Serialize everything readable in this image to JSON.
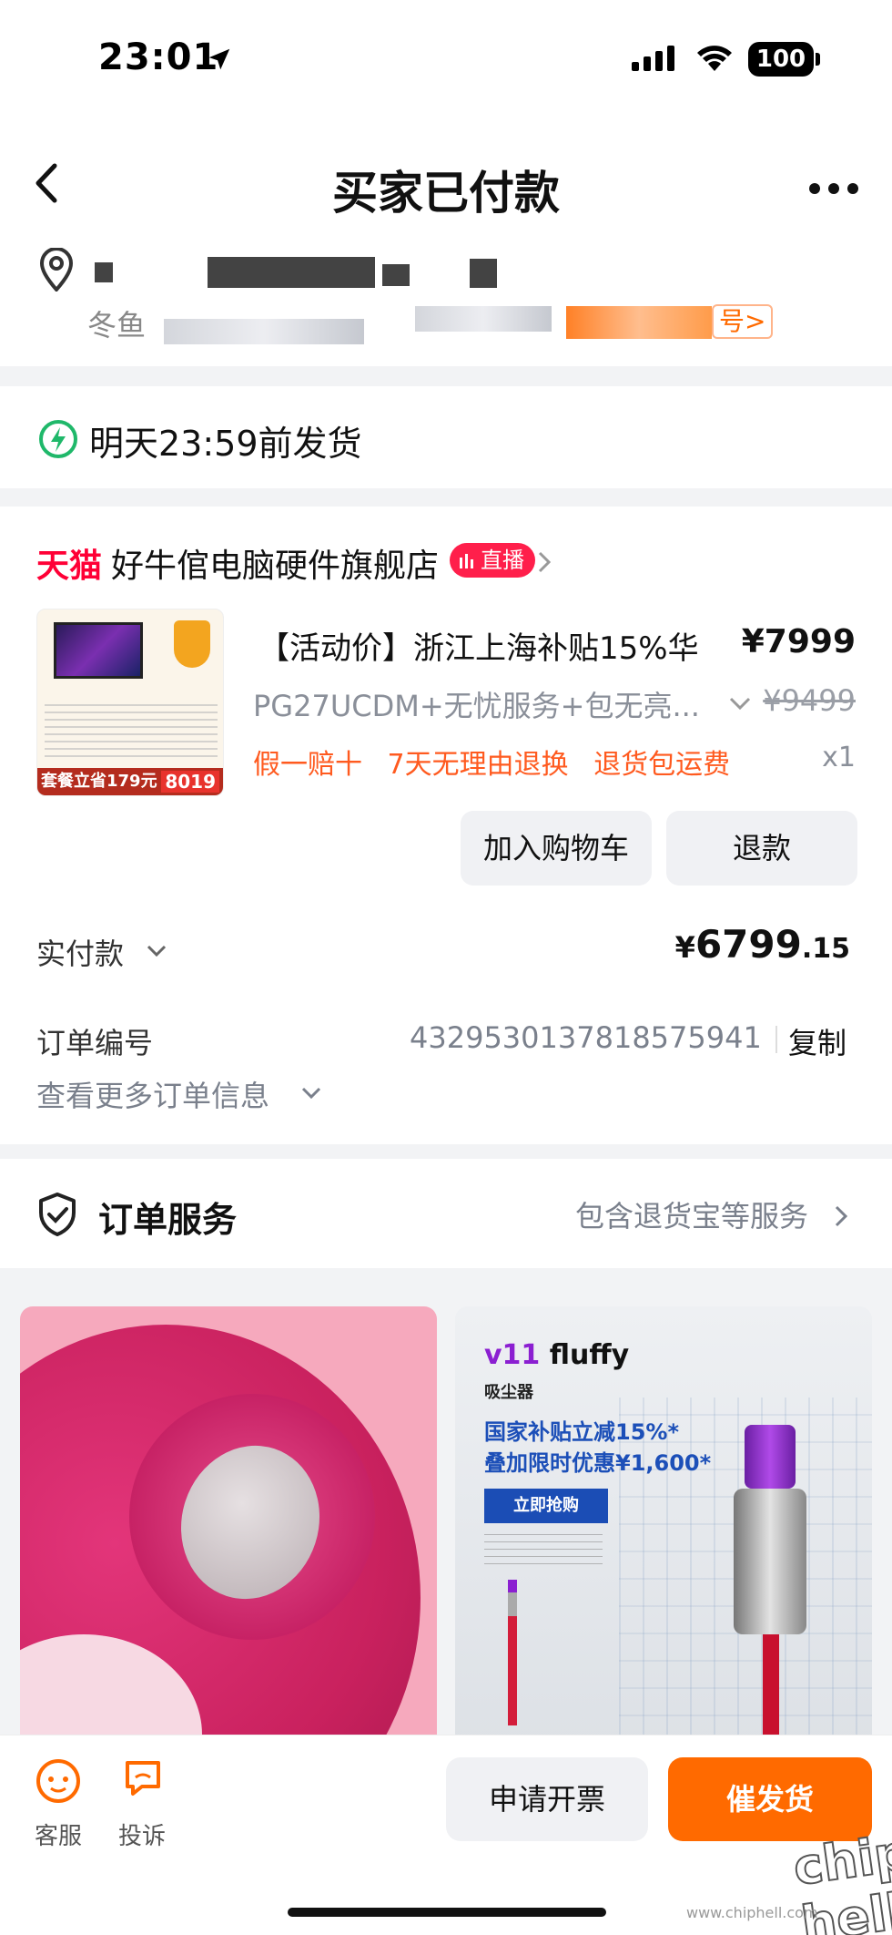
{
  "status_bar": {
    "time": "23:01",
    "battery": "100"
  },
  "nav": {
    "title": "买家已付款"
  },
  "address": {
    "sub_prefix": "冬鱼",
    "tag": "号>"
  },
  "shipping": {
    "text": "明天23:59前发货"
  },
  "shop": {
    "platform": "天猫",
    "name": "好牛倌电脑硬件旗舰店",
    "live_badge": "直播"
  },
  "product": {
    "title": "【活动价】浙江上海补贴15%华",
    "price": "¥7999",
    "spec": "PG27UCDM+无忧服务+包无亮...",
    "original_price": "¥9499",
    "tags": [
      "假一赔十",
      "7天无理由退换",
      "退货包运费"
    ],
    "quantity": "x1",
    "thumb_promo": "套餐立省179元",
    "thumb_price": "8019"
  },
  "actions": {
    "add_to_cart": "加入购物车",
    "refund": "退款"
  },
  "payment": {
    "label": "实付款",
    "currency": "¥",
    "integer": "6799",
    "decimal": ".15"
  },
  "order_info": {
    "number_label": "订单编号",
    "number": "4329530137818575941",
    "copy": "复制",
    "more": "查看更多订单信息"
  },
  "service": {
    "title": "订单服务",
    "link": "包含退货宝等服务"
  },
  "ads": {
    "right": {
      "brand_v": "v11",
      "brand_rest": " fluffy",
      "product": "吸尘器",
      "line1": "国家补贴立减15%*",
      "line2": "叠加限时优惠¥1,600*",
      "cta": "立即抢购"
    }
  },
  "bottom_bar": {
    "customer_service": "客服",
    "complain": "投诉",
    "invoice": "申请开票",
    "rush_ship": "催发货"
  },
  "watermark": "www.chiphell.com",
  "watermark_logo": "chip hell",
  "colors": {
    "accent": "#ff6a00",
    "tmall_red": "#ff0036",
    "ship_green": "#1fb86a"
  }
}
